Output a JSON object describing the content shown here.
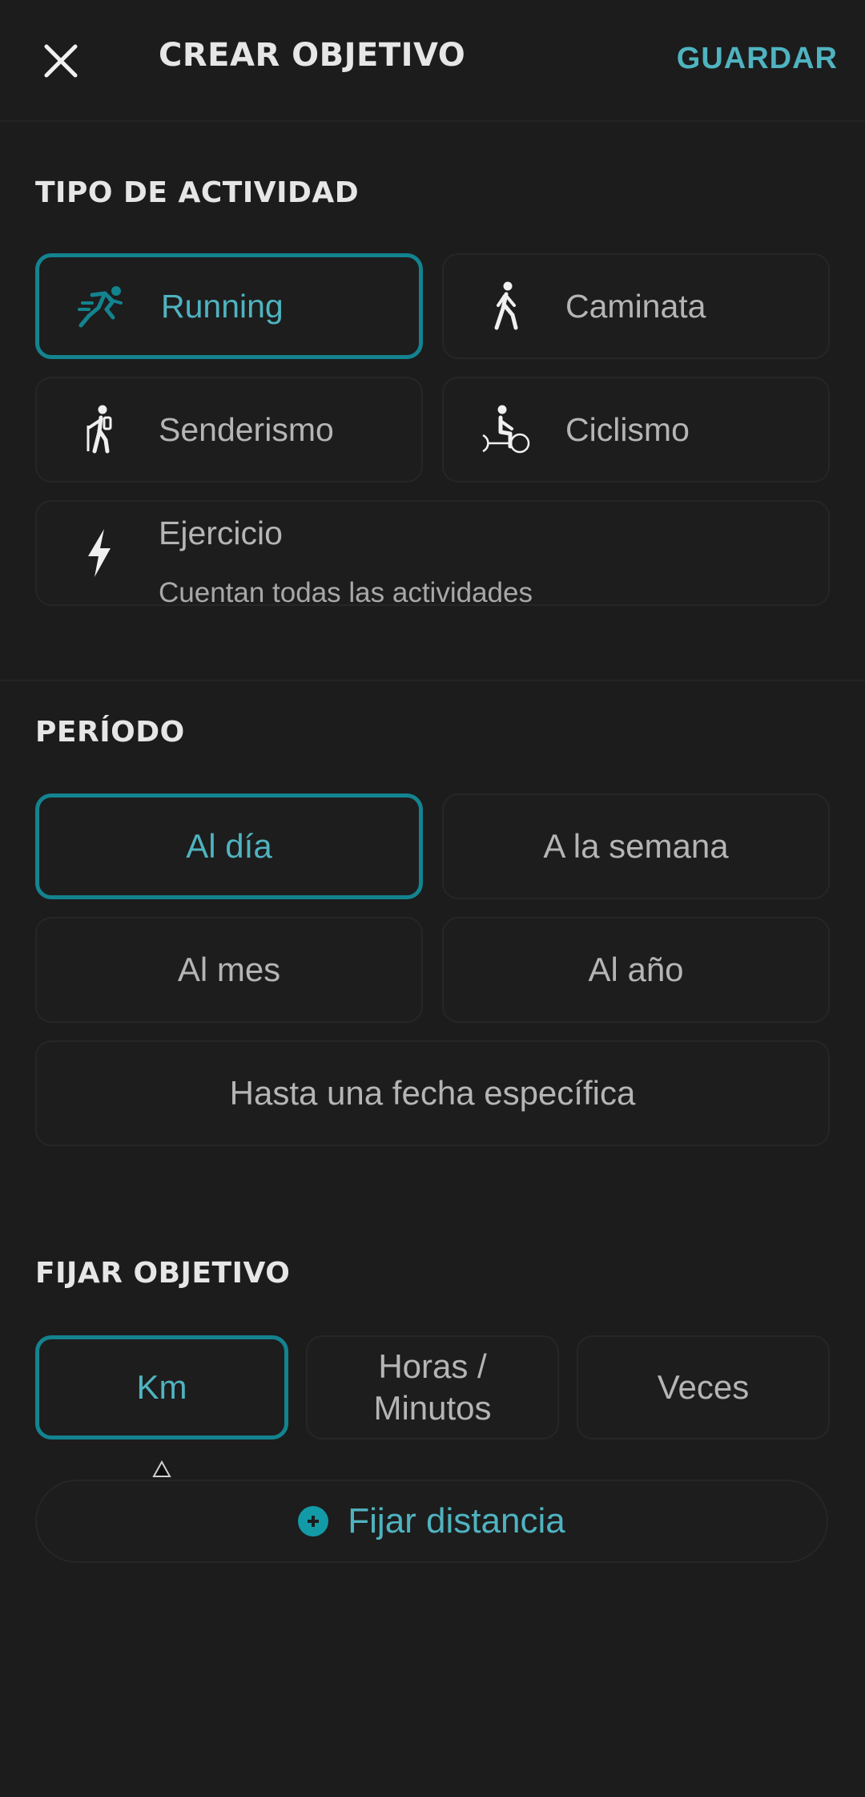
{
  "header": {
    "title": "CREAR OBJETIVO",
    "save_label": "GUARDAR",
    "close_icon": "close-icon"
  },
  "activity": {
    "title": "TIPO DE ACTIVIDAD",
    "items": [
      {
        "label": "Running",
        "icon": "running-icon",
        "selected": true
      },
      {
        "label": "Caminata",
        "icon": "walking-icon",
        "selected": false
      },
      {
        "label": "Senderismo",
        "icon": "hiking-icon",
        "selected": false
      },
      {
        "label": "Ciclismo",
        "icon": "cycling-icon",
        "selected": false
      },
      {
        "label": "Ejercicio",
        "sublabel": "Cuentan todas las actividades",
        "icon": "lightning-icon",
        "selected": false
      }
    ]
  },
  "period": {
    "title": "PERÍODO",
    "items": [
      {
        "label": "Al día",
        "selected": true
      },
      {
        "label": "A la semana",
        "selected": false
      },
      {
        "label": "Al mes",
        "selected": false
      },
      {
        "label": "Al año",
        "selected": false
      },
      {
        "label": "Hasta una fecha específica",
        "selected": false
      }
    ]
  },
  "goal": {
    "title": "FIJAR OBJETIVO",
    "units": [
      {
        "label": "Km",
        "selected": true
      },
      {
        "label": "Horas / Minutos",
        "selected": false
      },
      {
        "label": "Veces",
        "selected": false
      }
    ],
    "action_label": "Fijar distancia",
    "action_icon": "plus-circle-icon"
  },
  "colors": {
    "accent": "#4fb3c0",
    "selected_border": "#13838f",
    "background": "#1c1c1c"
  }
}
